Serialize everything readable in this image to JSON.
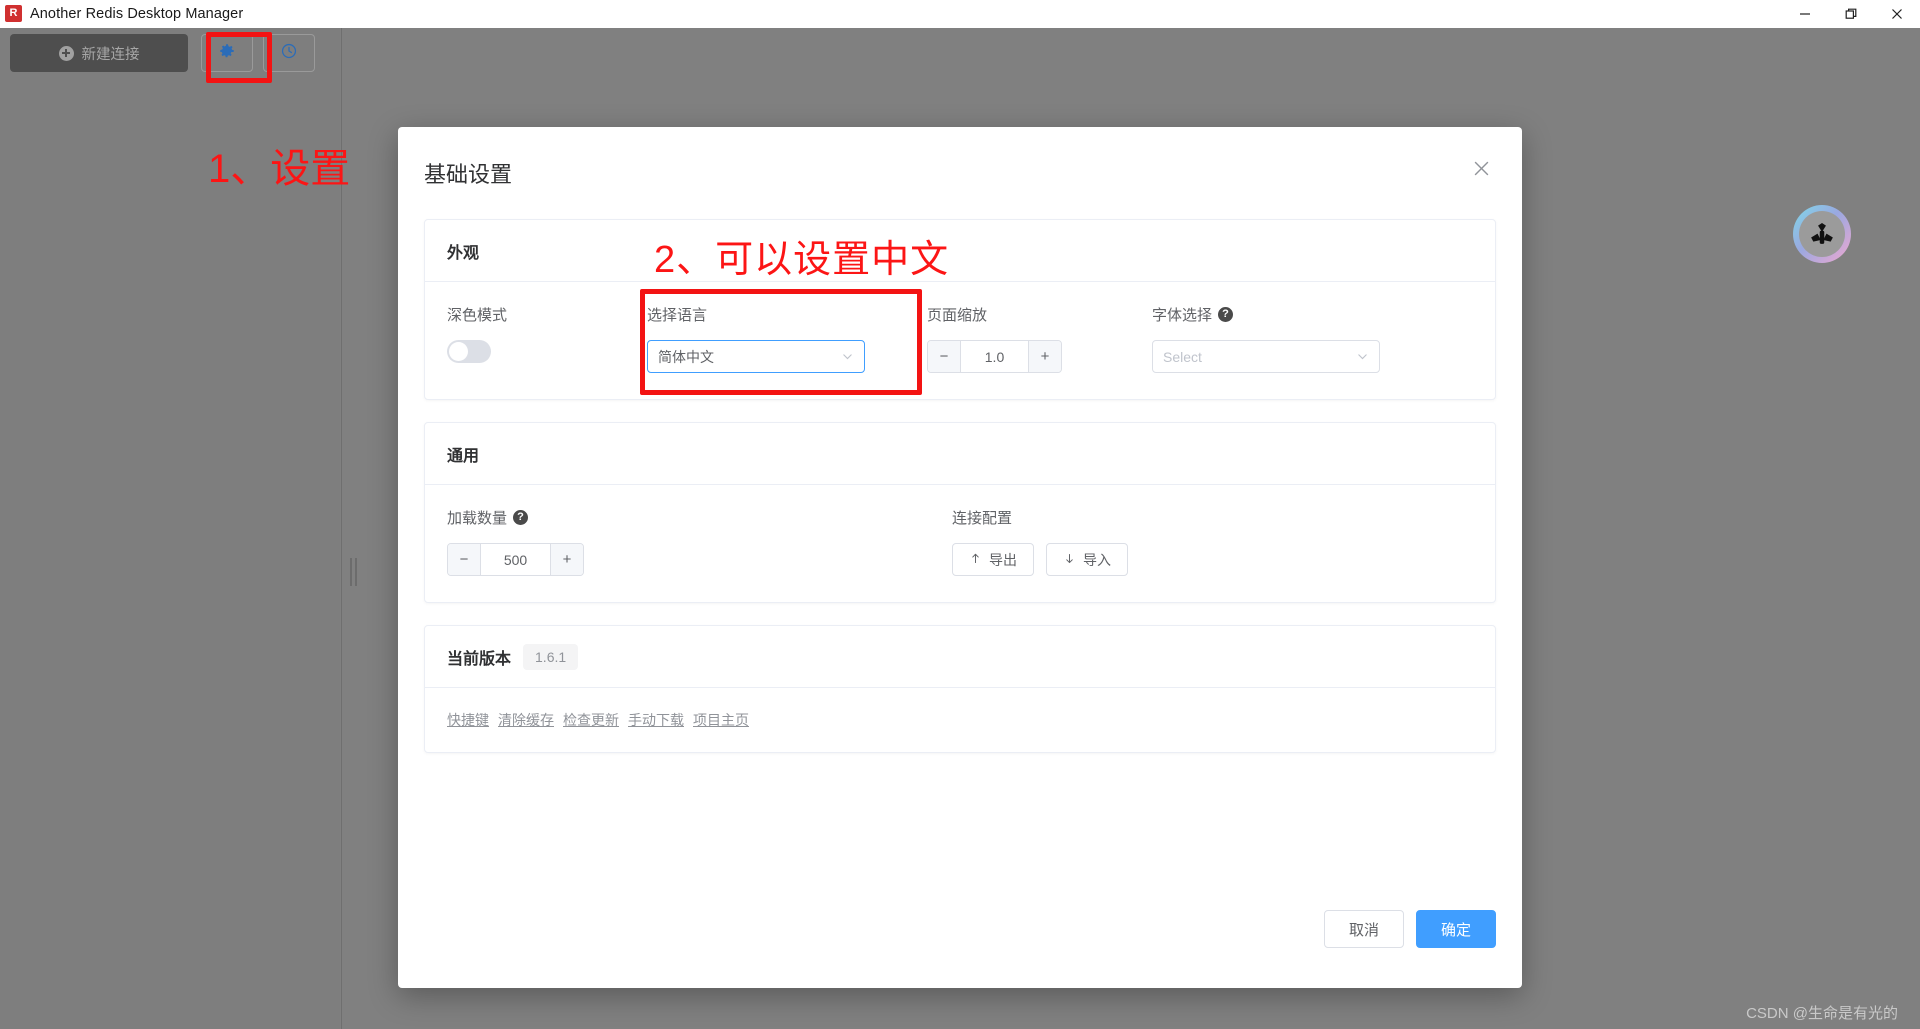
{
  "window": {
    "title": "Another Redis Desktop Manager",
    "app_icon": "redis-logo-icon",
    "minimize": "minimize-icon",
    "maximize": "maximize-icon",
    "close": "close-icon"
  },
  "toolbar": {
    "new_connection_label": "新建连接",
    "settings_icon": "gear-icon",
    "history_icon": "clock-icon"
  },
  "annotations": {
    "step1": "1、设置",
    "step2": "2、可以设置中文",
    "color": "#fc1515"
  },
  "dialog": {
    "title": "基础设置",
    "close_icon": "close-icon",
    "appearance": {
      "heading": "外观",
      "dark_mode": {
        "label": "深色模式",
        "value": "off"
      },
      "language": {
        "label": "选择语言",
        "value": "简体中文"
      },
      "page_zoom": {
        "label": "页面缩放",
        "value": "1.0",
        "minus": "−",
        "plus": "+"
      },
      "font": {
        "label": "字体选择",
        "placeholder": "Select",
        "help_icon": "question-icon"
      }
    },
    "general": {
      "heading": "通用",
      "load_count": {
        "label": "加载数量",
        "value": "500",
        "minus": "−",
        "plus": "+",
        "help_icon": "question-icon"
      },
      "connection_config": {
        "label": "连接配置",
        "export_label": "导出",
        "import_label": "导入",
        "export_icon": "upload-icon",
        "import_icon": "download-icon"
      }
    },
    "version": {
      "heading": "当前版本",
      "number": "1.6.1",
      "links": [
        "快捷键",
        "清除缓存",
        "检查更新",
        "手动下载",
        "项目主页"
      ]
    },
    "footer": {
      "cancel_label": "取消",
      "confirm_label": "确定",
      "confirm_color": "#409eff"
    }
  },
  "float_badge": {
    "icon": "triple-chevron-logo-icon"
  },
  "watermark": "CSDN @生命是有光的"
}
